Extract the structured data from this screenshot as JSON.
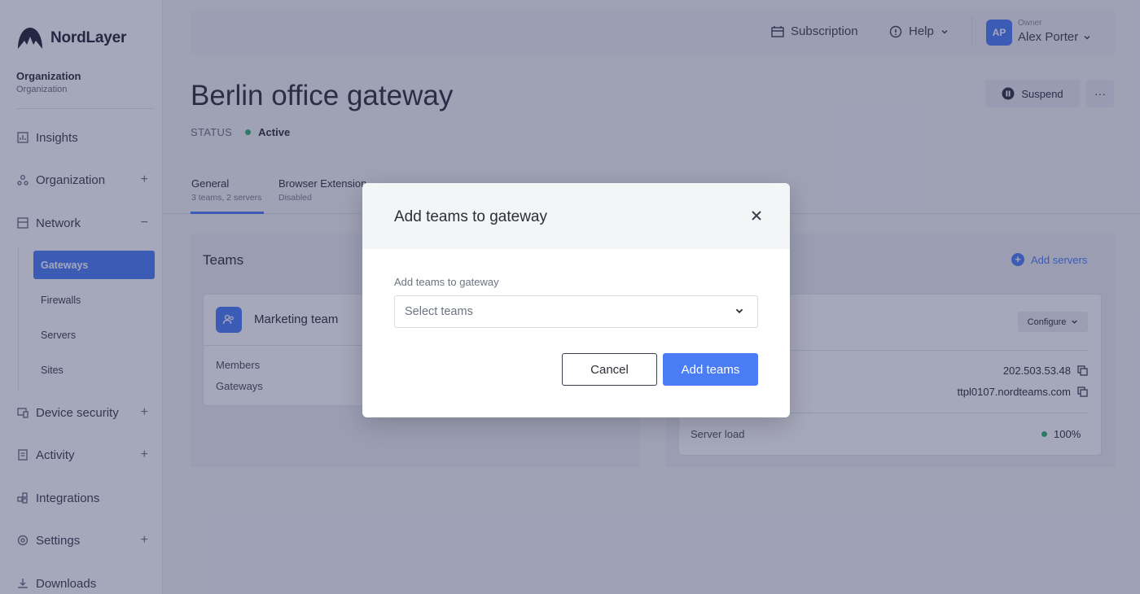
{
  "brand": {
    "name": "NordLayer"
  },
  "org": {
    "name": "Organization",
    "sub": "Organization"
  },
  "nav": {
    "insights": "Insights",
    "organization": "Organization",
    "network": "Network",
    "device_security": "Device security",
    "activity": "Activity",
    "integrations": "Integrations",
    "settings": "Settings",
    "downloads": "Downloads",
    "plus": "+",
    "minus": "−"
  },
  "network_sub": [
    "Gateways",
    "Firewalls",
    "Servers",
    "Sites"
  ],
  "topbar": {
    "subscription": "Subscription",
    "help": "Help",
    "avatar_initials": "AP",
    "owner_label": "Owner",
    "owner_name": "Alex Porter"
  },
  "page": {
    "title": "Berlin office gateway",
    "status_label": "STATUS",
    "status_value": "Active",
    "suspend": "Suspend",
    "more": "···"
  },
  "tabs": [
    {
      "label": "General",
      "sub": "3 teams, 2 servers"
    },
    {
      "label": "Browser Extension",
      "sub": "Disabled"
    }
  ],
  "teams_panel": {
    "title": "Teams",
    "team_name": "Marketing team",
    "members_label": "Members",
    "gateways_label": "Gateways"
  },
  "servers_panel": {
    "add_servers": "Add servers",
    "configure": "Configure",
    "ip": "202.503.53.48",
    "hostname": "ttpl0107.nordteams.com",
    "server_load_label": "Server load",
    "server_load_value": "100%"
  },
  "modal": {
    "title": "Add teams to gateway",
    "field_label": "Add teams to gateway",
    "select_placeholder": "Select teams",
    "cancel": "Cancel",
    "add": "Add teams"
  },
  "colors": {
    "accent": "#4a7cf6",
    "success": "#31b36b"
  }
}
